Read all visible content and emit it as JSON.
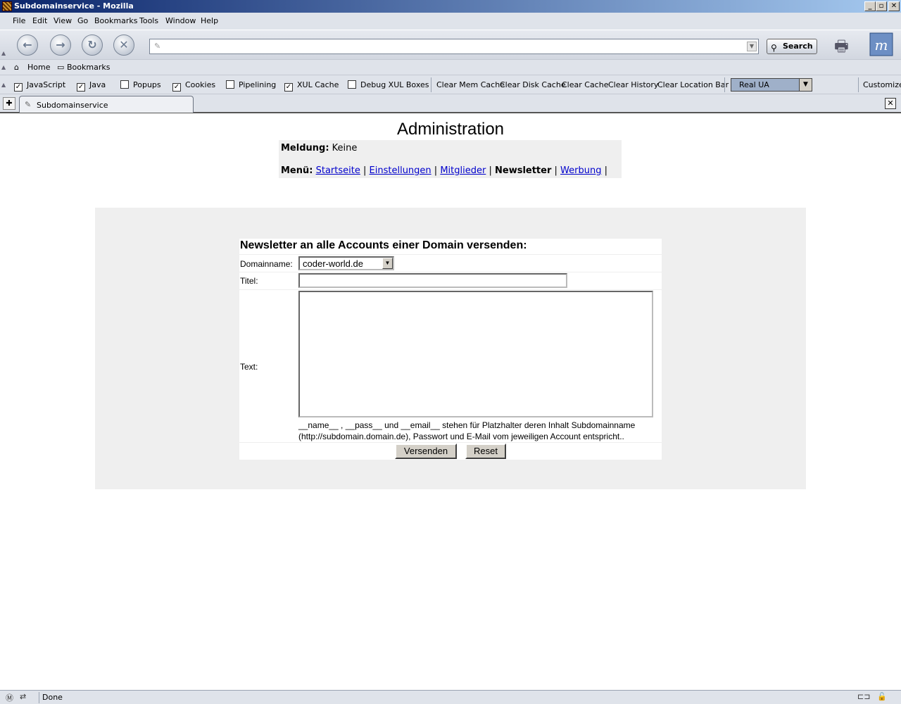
{
  "window": {
    "title": "Subdomainservice - Mozilla",
    "min": "_",
    "max": "▫",
    "close": "✕"
  },
  "menu": [
    "File",
    "Edit",
    "View",
    "Go",
    "Bookmarks",
    "Tools",
    "Window",
    "Help"
  ],
  "navbar": {
    "search_label": "Search",
    "url_value": ""
  },
  "personal": {
    "home": "Home",
    "bookmarks": "Bookmarks"
  },
  "prefbar": {
    "checks": [
      {
        "label": "JavaScript",
        "checked": true
      },
      {
        "label": "Java",
        "checked": true
      },
      {
        "label": "Popups",
        "checked": false
      },
      {
        "label": "Cookies",
        "checked": true
      },
      {
        "label": "Pipelining",
        "checked": false
      },
      {
        "label": "XUL Cache",
        "checked": true
      },
      {
        "label": "Debug XUL Boxes",
        "checked": false
      }
    ],
    "buttons": [
      "Clear Mem Cache",
      "Clear Disk Cache",
      "Clear Cache",
      "Clear History",
      "Clear Location Bar"
    ],
    "ua_select": "Real UA",
    "customize": "Customize"
  },
  "tab": {
    "label": "Subdomainservice"
  },
  "page": {
    "title": "Administration",
    "message_label": "Meldung:",
    "message_value": "Keine",
    "menu_label": "Menü:",
    "menu_links": [
      "Startseite",
      "Einstellungen",
      "Mitglieder"
    ],
    "menu_current": "Newsletter",
    "menu_link_last": "Werbung",
    "sep": "|"
  },
  "form": {
    "heading": "Newsletter an alle Accounts einer Domain versenden:",
    "domain_label": "Domainname:",
    "domain_value": "coder-world.de",
    "title_label": "Titel:",
    "title_value": "",
    "text_label": "Text:",
    "text_value": "",
    "hint_line1": "__name__ , __pass__ und __email__ stehen für Platzhalter deren Inhalt Subdomainname",
    "hint_line2": "(http://subdomain.domain.de), Passwort und E-Mail vom jeweiligen Account entspricht..",
    "submit_label": "Versenden",
    "reset_label": "Reset"
  },
  "status": {
    "text": "Done"
  },
  "colors": {
    "link": "#0000cc",
    "panel": "#efefef",
    "chrome": "#dfe3ea",
    "titlebar": "#0a246a"
  }
}
